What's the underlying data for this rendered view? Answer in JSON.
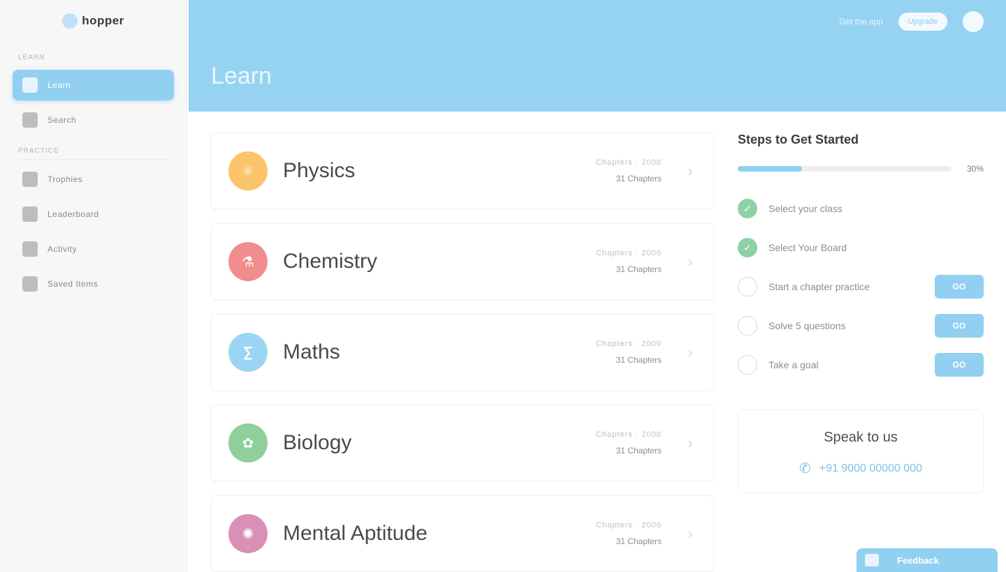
{
  "sidebar": {
    "logo_text": "hopper",
    "section_top": "LEARN",
    "section_bottom": "PRACTICE",
    "items": [
      {
        "label": "Learn",
        "icon": "book-icon",
        "active": true
      },
      {
        "label": "Search",
        "icon": "search-icon"
      },
      {
        "label": "Trophies",
        "icon": "trophy-icon"
      },
      {
        "label": "Leaderboard",
        "icon": "leaderboard-icon"
      },
      {
        "label": "Activity",
        "icon": "activity-icon"
      },
      {
        "label": "Saved Items",
        "icon": "saved-icon"
      }
    ]
  },
  "header": {
    "link_text": "Get the app",
    "pill_text": "Upgrade",
    "title": "Learn"
  },
  "subjects": [
    {
      "name": "Physics",
      "meta_top": "Chapters · 2000",
      "meta_bottom": "31 Chapters",
      "color": "#f9c46b",
      "icon": "physics-icon",
      "glyph": "⚛"
    },
    {
      "name": "Chemistry",
      "meta_top": "Chapters · 2000",
      "meta_bottom": "31 Chapters",
      "color": "#ef8e8c",
      "icon": "chemistry-icon",
      "glyph": "⚗"
    },
    {
      "name": "Maths",
      "meta_top": "Chapters · 2000",
      "meta_bottom": "31 Chapters",
      "color": "#9cd4f3",
      "icon": "maths-icon",
      "glyph": "∑"
    },
    {
      "name": "Biology",
      "meta_top": "Chapters · 2000",
      "meta_bottom": "31 Chapters",
      "color": "#8fcf9c",
      "icon": "biology-icon",
      "glyph": "✿"
    },
    {
      "name": "Mental Aptitude",
      "meta_top": "Chapters · 2000",
      "meta_bottom": "31 Chapters",
      "color": "#d990b7",
      "icon": "aptitude-icon",
      "glyph": "✺"
    }
  ],
  "steps": {
    "title": "Steps to Get Started",
    "progress_percent": 30,
    "progress_text": "30%",
    "items": [
      {
        "label": "Select your class",
        "done": true,
        "button": ""
      },
      {
        "label": "Select Your Board",
        "done": true,
        "button": ""
      },
      {
        "label": "Start a chapter practice",
        "done": false,
        "button": "GO"
      },
      {
        "label": "Solve 5 questions",
        "done": false,
        "button": "GO"
      },
      {
        "label": "Take a goal",
        "done": false,
        "button": "GO"
      }
    ]
  },
  "speak": {
    "title": "Speak to us",
    "phone": "+91 9000 00000 000"
  },
  "feedback": {
    "label": "Feedback"
  },
  "colors": {
    "accent": "#92d0f1",
    "header_bg": "#96d3f2",
    "success": "#8fd0a6"
  }
}
